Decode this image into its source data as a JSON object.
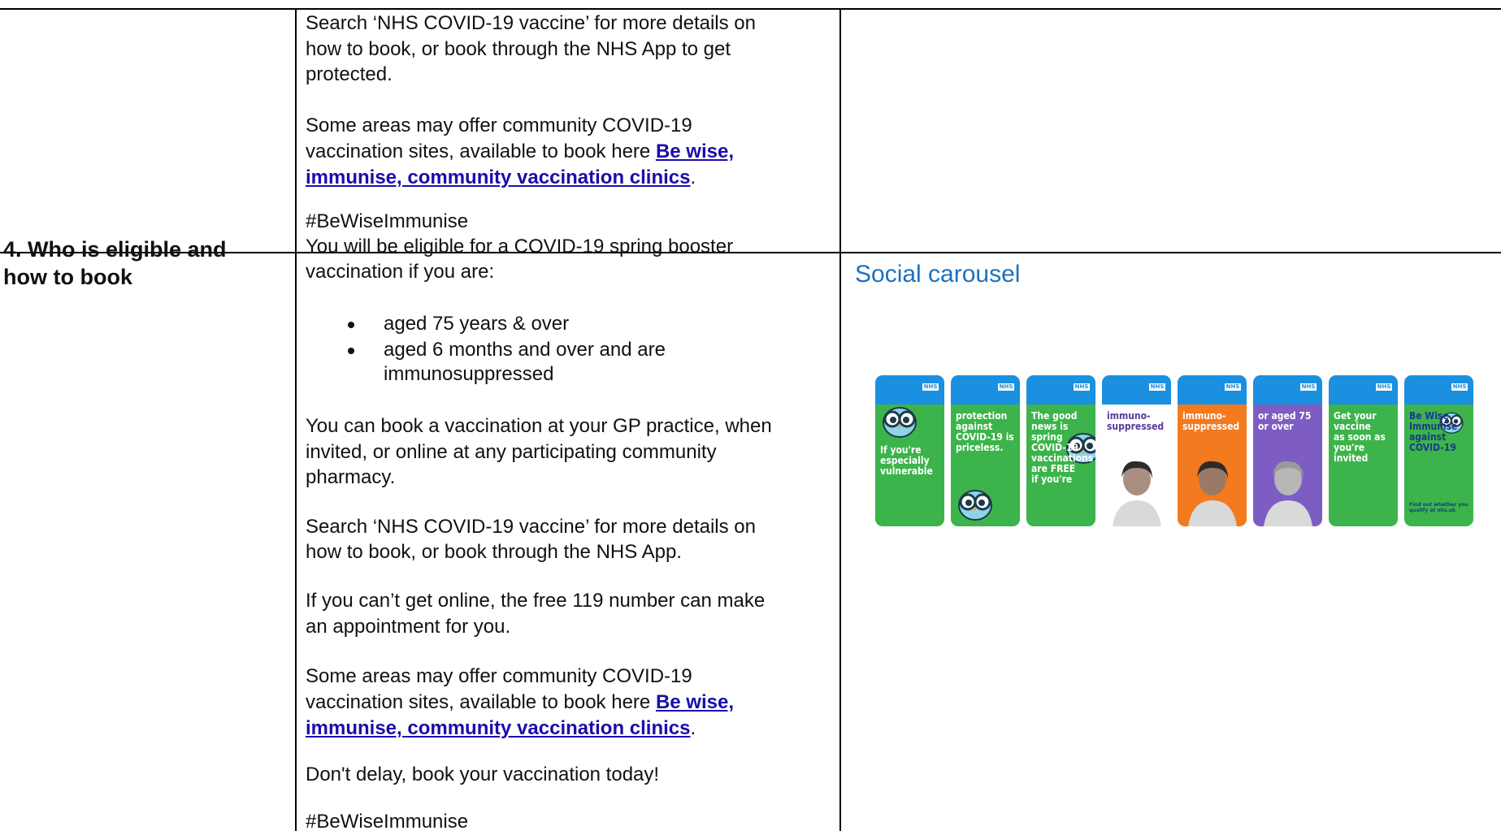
{
  "rows": [
    {
      "heading": "",
      "body": {
        "para1": [
          "Search ‘NHS COVID-19 vaccine’ for more details on",
          "how to book, or book through the NHS App to get",
          "protected."
        ],
        "para2": [
          "Some areas may offer community COVID-19",
          "vaccination sites, available to book here"
        ],
        "link": [
          "Be wise,",
          "immunise, community vaccination clinics"
        ],
        "link_suffix": ".",
        "hashtag": "#BeWiseImmunise"
      }
    },
    {
      "heading": [
        "4. Who is eligible and",
        "how to book"
      ],
      "body": {
        "intro": [
          "You will be eligible for a COVID-19 spring booster",
          "vaccination if you are:"
        ],
        "bullets": [
          [
            "aged 75 years & over"
          ],
          [
            "aged 6 months and over and are",
            "immunosuppressed"
          ]
        ],
        "para_book": [
          "You can book a vaccination at your GP practice, when",
          "invited, or online at any participating community",
          "pharmacy."
        ],
        "para_search": [
          "Search ‘NHS COVID-19 vaccine’ for more details on",
          "how to book, or book through the NHS App."
        ],
        "para_119": [
          "If you can’t get online, the free 119 number can make",
          "an appointment for you."
        ],
        "para_community": [
          "Some areas may offer community COVID-19",
          "vaccination sites, available to book here"
        ],
        "link": [
          "Be wise,",
          "immunise, community vaccination clinics"
        ],
        "link_suffix": ".",
        "para_delay": "Don't delay, book your vaccination today!",
        "hashtag": "#BeWiseImmunise"
      },
      "asset": {
        "title": "Social carousel",
        "cards": [
          {
            "badge": "NHS",
            "text": "If you're\nespecially\nvulnerable",
            "bg": "#3cb44b",
            "fg": "#ffffff",
            "icon": "owl-icon"
          },
          {
            "badge": "NHS",
            "text": "protection\nagainst\nCOVID-19 is\npriceless.",
            "bg": "#3cb44b",
            "fg": "#ffffff",
            "icon": "owl-icon"
          },
          {
            "badge": "NHS",
            "text": "The good\nnews is\nspring\nCOVID-19\nvaccinations\nare FREE\nif you're",
            "bg": "#3cb44b",
            "fg": "#ffffff",
            "icon": "owl-icon"
          },
          {
            "badge": "NHS",
            "text": "immuno-\nsuppressed",
            "bg": "#ffffff",
            "fg": "#5b3a9b",
            "icon": "person-photo"
          },
          {
            "badge": "NHS",
            "text": "immuno-\nsuppressed",
            "bg": "#f47a1f",
            "fg": "#ffffff",
            "icon": "child-photo"
          },
          {
            "badge": "NHS",
            "text": "or aged 75\nor over",
            "bg": "#7d5cc4",
            "fg": "#ffffff",
            "icon": "senior-photo"
          },
          {
            "badge": "NHS",
            "text": "Get your\nvaccine\nas soon as\nyou're invited",
            "bg": "#3cb44b",
            "fg": "#ffffff",
            "icon": "none"
          },
          {
            "badge": "NHS",
            "text": "Be Wise.\nImmunise\nagainst\nCOVID-19",
            "bg": "#3cb44b",
            "fg": "#1c3a8a",
            "footer": "Find out whether you qualify at nhs.uk",
            "icon": "owl-icon"
          }
        ]
      }
    }
  ]
}
